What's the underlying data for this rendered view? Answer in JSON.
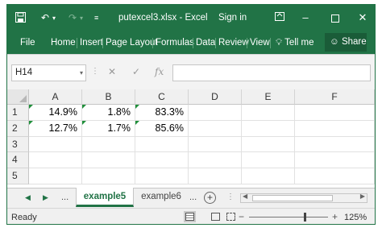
{
  "titlebar": {
    "filename": "putexcel3.xlsx",
    "separator": "-",
    "app": "Excel",
    "signin": "Sign in"
  },
  "ribbon": {
    "tabs": [
      "File",
      "Home",
      "Insert",
      "Page Layout",
      "Formulas",
      "Data",
      "Review",
      "View"
    ],
    "tellme": "Tell me",
    "share": "Share"
  },
  "formula_bar": {
    "name_box": "H14",
    "fx": "fx",
    "value": ""
  },
  "sheet": {
    "columns": [
      "A",
      "B",
      "C",
      "D",
      "E",
      "F"
    ],
    "rows": [
      {
        "num": "1",
        "cells": [
          "14.9%",
          "1.8%",
          "83.3%",
          "",
          "",
          ""
        ]
      },
      {
        "num": "2",
        "cells": [
          "12.7%",
          "1.7%",
          "85.6%",
          "",
          "",
          ""
        ]
      },
      {
        "num": "3",
        "cells": [
          "",
          "",
          "",
          "",
          "",
          ""
        ]
      },
      {
        "num": "4",
        "cells": [
          "",
          "",
          "",
          "",
          "",
          ""
        ]
      },
      {
        "num": "5",
        "cells": [
          "",
          "",
          "",
          "",
          "",
          ""
        ]
      }
    ]
  },
  "sheet_tabs": {
    "more_left": "...",
    "tabs": [
      "example5",
      "example6"
    ],
    "more_right": "...",
    "active": "example5"
  },
  "status": {
    "ready": "Ready",
    "zoom": "125%"
  },
  "colors": {
    "accent": "#217346",
    "flag": "#1f8f3a"
  }
}
